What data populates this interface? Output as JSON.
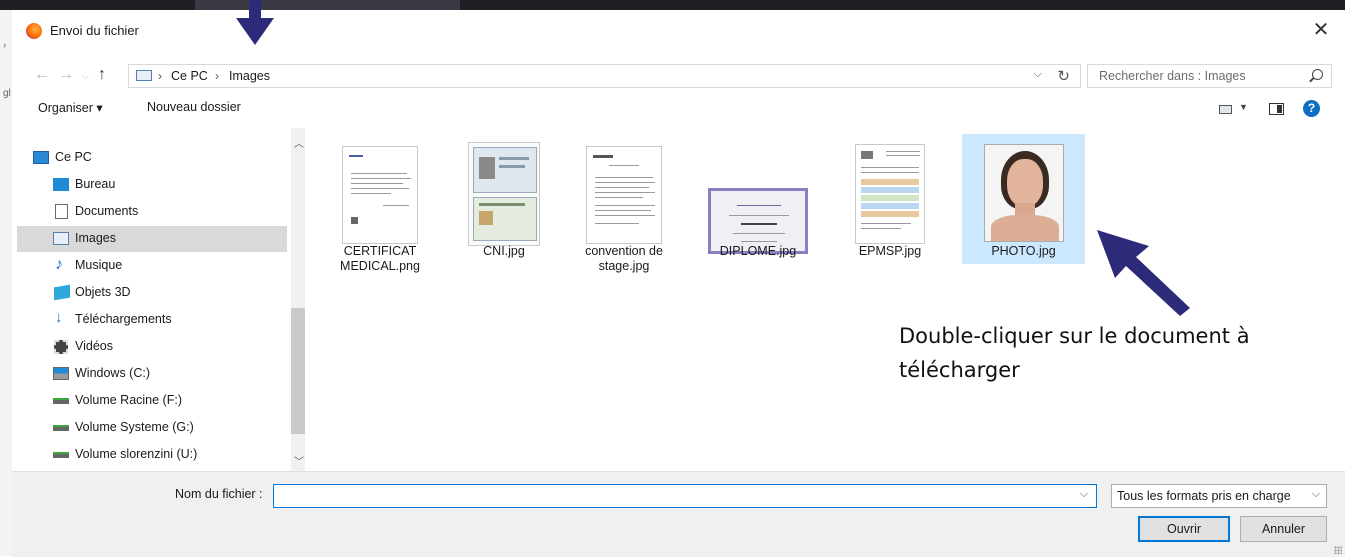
{
  "window": {
    "title": "Envoi du fichier",
    "close_label": "✕"
  },
  "address_bar": {
    "crumbs": [
      "Ce PC",
      "Images"
    ],
    "separator": "›"
  },
  "search": {
    "placeholder": "Rechercher dans : Images"
  },
  "command_bar": {
    "organize": "Organiser ▾",
    "new_folder": "Nouveau dossier",
    "help": "?"
  },
  "nav_pane": {
    "items": [
      {
        "label": "Ce PC",
        "icon": "computer-icon"
      },
      {
        "label": "Bureau",
        "icon": "desktop-icon"
      },
      {
        "label": "Documents",
        "icon": "documents-icon"
      },
      {
        "label": "Images",
        "icon": "pictures-icon",
        "selected": true
      },
      {
        "label": "Musique",
        "icon": "music-icon"
      },
      {
        "label": "Objets 3D",
        "icon": "3d-objects-icon"
      },
      {
        "label": "Téléchargements",
        "icon": "downloads-icon"
      },
      {
        "label": "Vidéos",
        "icon": "videos-icon"
      },
      {
        "label": "Windows (C:)",
        "icon": "windows-drive-icon"
      },
      {
        "label": "Volume Racine (F:)",
        "icon": "network-drive-icon"
      },
      {
        "label": "Volume Systeme (G:)",
        "icon": "network-drive-icon"
      },
      {
        "label": "Volume slorenzini (U:)",
        "icon": "network-drive-icon"
      }
    ]
  },
  "files": [
    {
      "name_line1": "CERTIFICAT",
      "name_line2": "MEDICAL.png",
      "thumb": "document"
    },
    {
      "name_line1": "CNI.jpg",
      "name_line2": "",
      "thumb": "id-card"
    },
    {
      "name_line1": "convention de",
      "name_line2": "stage.jpg",
      "thumb": "document"
    },
    {
      "name_line1": "DIPLOME.jpg",
      "name_line2": "",
      "thumb": "diploma"
    },
    {
      "name_line1": "EPMSP.jpg",
      "name_line2": "",
      "thumb": "form"
    },
    {
      "name_line1": "PHOTO.jpg",
      "name_line2": "",
      "thumb": "portrait",
      "selected": true
    }
  ],
  "annotation": {
    "line1": "Double-cliquer sur le document à",
    "line2": "télécharger",
    "color": "#2e2a7a"
  },
  "bottom": {
    "filename_label": "Nom du fichier :",
    "filename_value": "",
    "filter_value": "Tous les formats pris en charge",
    "open_button": "Ouvrir",
    "cancel_button": "Annuler"
  },
  "colors": {
    "accent": "#0078d7",
    "selection": "#cce8ff",
    "arrow": "#2e2a7a"
  }
}
